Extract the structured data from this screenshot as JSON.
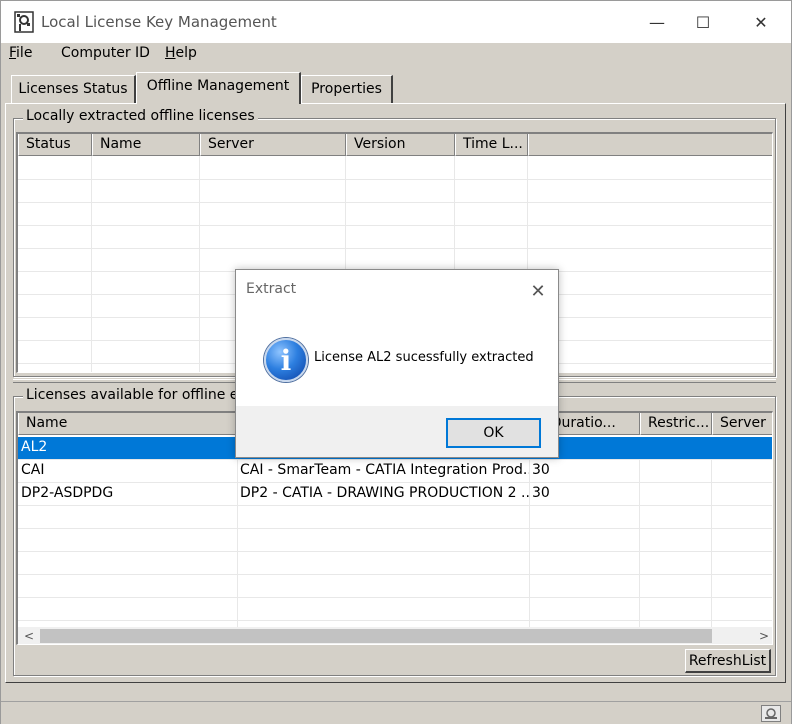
{
  "window": {
    "title": "Local License Key Management",
    "controls": {
      "minimize": "—",
      "maximize": "☐",
      "close": "✕"
    }
  },
  "menu": {
    "items": [
      {
        "label": "File",
        "mnemonic": "F",
        "rest": "ile"
      },
      {
        "label": "Computer ID"
      },
      {
        "label": "Help",
        "mnemonic": "H",
        "rest": "elp"
      }
    ]
  },
  "tabs": [
    {
      "label": "Licenses Status"
    },
    {
      "label": "Offline Management",
      "active": true
    },
    {
      "label": "Properties"
    }
  ],
  "extracted": {
    "group_label": "Locally extracted offline licenses",
    "columns": [
      "Status",
      "Name",
      "Server",
      "Version",
      "Time L..."
    ]
  },
  "available": {
    "group_label": "Licenses available for offline ext",
    "columns": [
      "Name",
      "",
      "x Duratio...",
      "Restric...",
      "Server"
    ],
    "rows": [
      {
        "name": "AL2",
        "desc": "",
        "duration": "",
        "selected": true
      },
      {
        "name": "CAI",
        "desc": "CAI - SmarTeam - CATIA Integration Prod...",
        "duration": "30"
      },
      {
        "name": "DP2-ASDPDG",
        "desc": "DP2 - CATIA - DRAWING PRODUCTION 2 ...",
        "duration": "30"
      }
    ],
    "scroll_left": "<",
    "scroll_right": ">"
  },
  "refresh_button": "RefreshList",
  "dialog": {
    "title": "Extract",
    "close": "✕",
    "icon_glyph": "i",
    "message": "License AL2 sucessfully extracted",
    "ok_label": "OK"
  },
  "colors": {
    "selection": "#0078d7",
    "face": "#d4d0c8"
  }
}
